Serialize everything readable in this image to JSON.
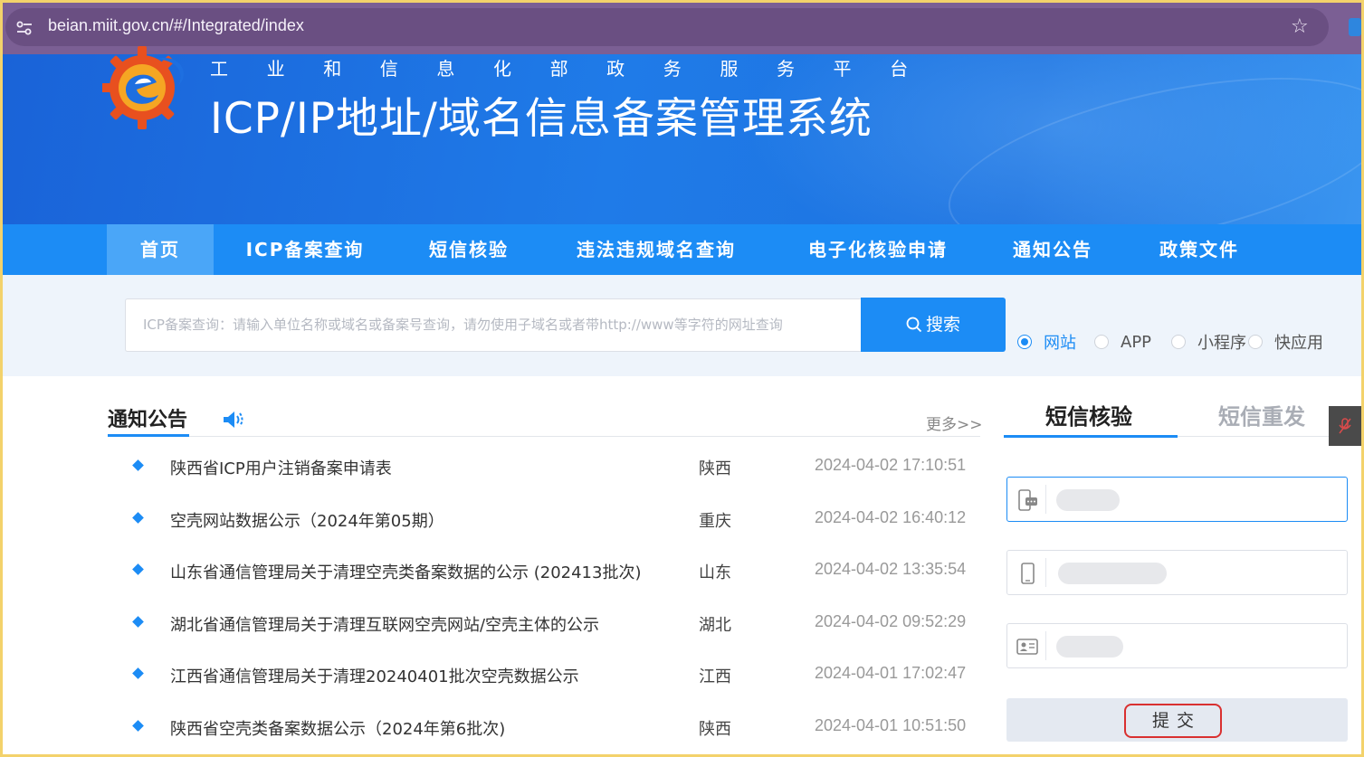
{
  "browser": {
    "url": "beian.miit.gov.cn/#/Integrated/index",
    "site_settings_icon": "tune-icon",
    "bookmark_icon": "star-icon"
  },
  "header": {
    "subtitle_chars": [
      "工",
      "业",
      "和",
      "信",
      "息",
      "化",
      "部",
      "政",
      "务",
      "服",
      "务",
      "平",
      "台"
    ],
    "title": "ICP/IP地址/域名信息备案管理系统",
    "logo_icon": "gear-logo-icon"
  },
  "nav": {
    "items": [
      {
        "label": "首页",
        "active": true
      },
      {
        "label": "ICP备案查询"
      },
      {
        "label": "短信核验"
      },
      {
        "label": "违法违规域名查询"
      },
      {
        "label": "电子化核验申请"
      },
      {
        "label": "通知公告"
      },
      {
        "label": "政策文件"
      }
    ]
  },
  "search": {
    "placeholder": "ICP备案查询：请输入单位名称或域名或备案号查询，请勿使用子域名或者带http://www等字符的网址查询",
    "button_label": "搜索",
    "types": [
      {
        "label": "网站",
        "checked": true
      },
      {
        "label": "APP"
      },
      {
        "label": "小程序"
      },
      {
        "label": "快应用"
      }
    ]
  },
  "notices": {
    "heading": "通知公告",
    "more_label": "更多>>",
    "items": [
      {
        "title": "陕西省ICP用户注销备案申请表",
        "province": "陕西",
        "time": "2024-04-02 17:10:51"
      },
      {
        "title": "空壳网站数据公示（2024年第05期）",
        "province": "重庆",
        "time": "2024-04-02 16:40:12"
      },
      {
        "title": "山东省通信管理局关于清理空壳类备案数据的公示 (202413批次)",
        "province": "山东",
        "time": "2024-04-02 13:35:54"
      },
      {
        "title": "湖北省通信管理局关于清理互联网空壳网站/空壳主体的公示",
        "province": "湖北",
        "time": "2024-04-02 09:52:29"
      },
      {
        "title": "江西省通信管理局关于清理20240401批次空壳数据公示",
        "province": "江西",
        "time": "2024-04-01 17:02:47"
      },
      {
        "title": "陕西省空壳类备案数据公示（2024年第6批次)",
        "province": "陕西",
        "time": "2024-04-01 10:51:50"
      }
    ]
  },
  "sms_panel": {
    "tabs": [
      {
        "label": "短信核验",
        "active": true
      },
      {
        "label": "短信重发"
      }
    ],
    "submit_label": "提交"
  }
}
